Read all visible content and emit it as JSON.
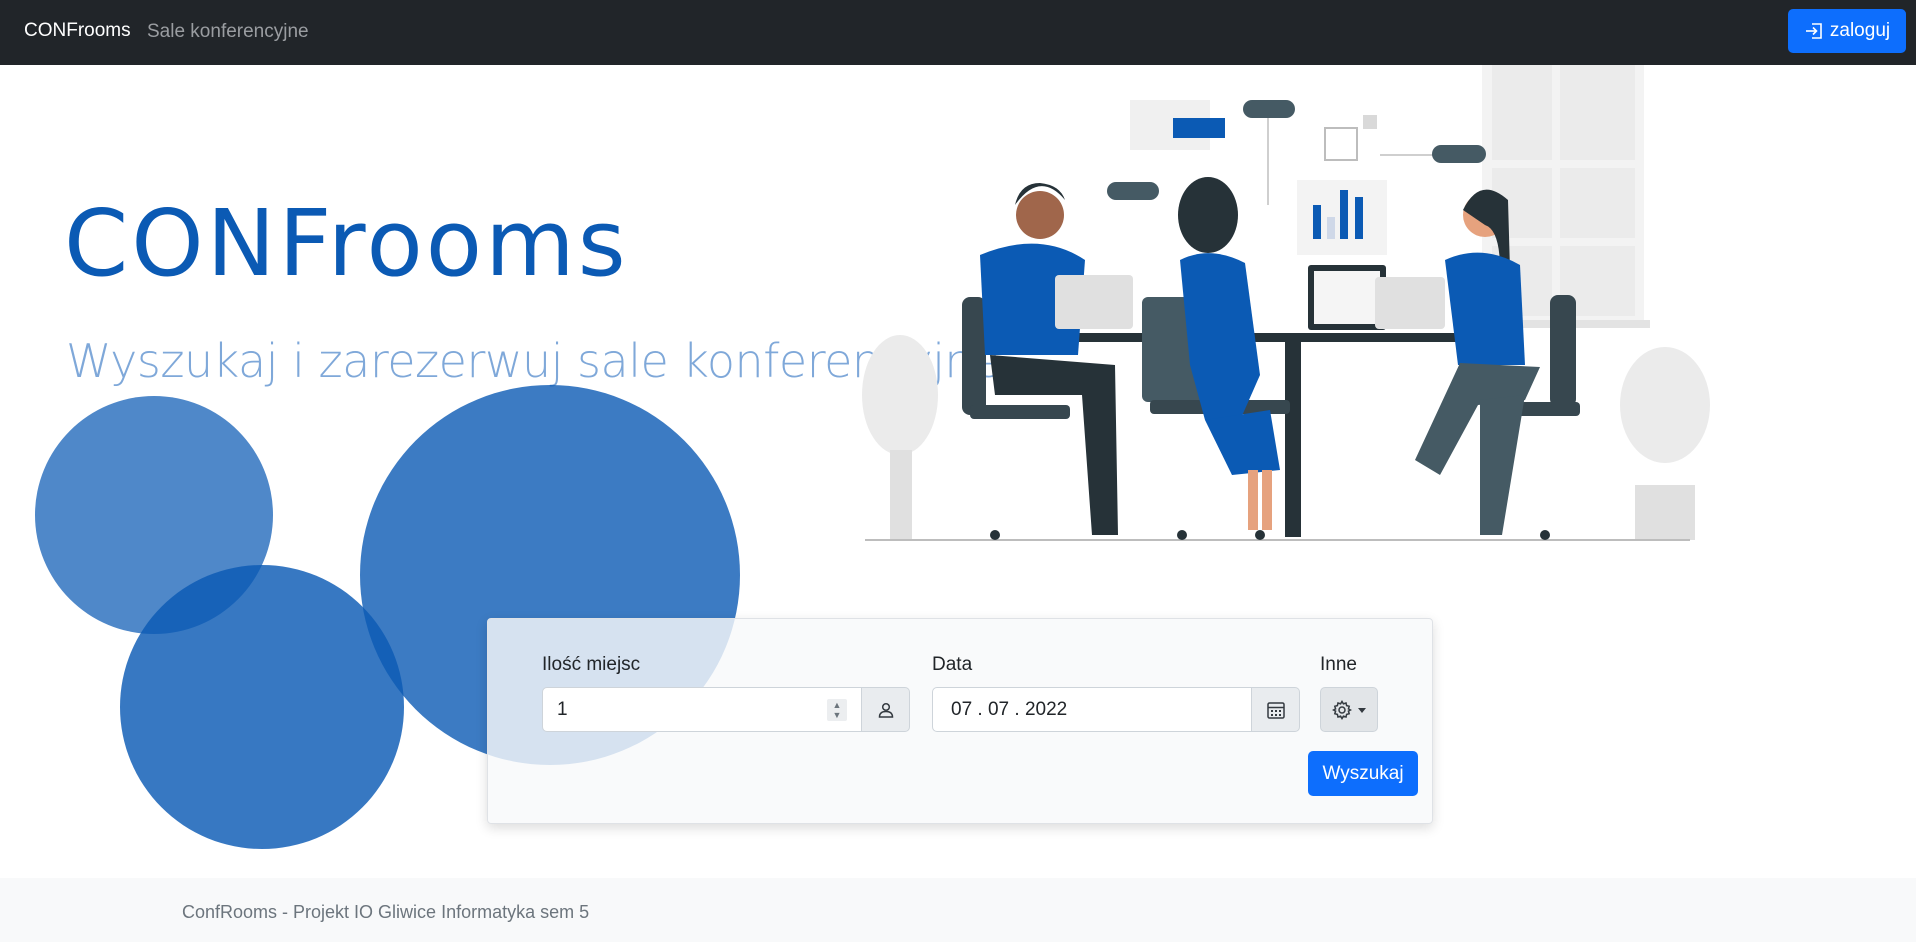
{
  "navbar": {
    "brand": "CONFrooms",
    "nav_link": "Sale konferencyjne",
    "login_label": "zaloguj",
    "login_icon": "login-icon"
  },
  "hero": {
    "title": "CONFrooms",
    "subtitle": "Wyszukaj i zarezerwuj sale konferencyjne"
  },
  "search": {
    "seats_label": "Ilość miejsc",
    "seats_value": "1",
    "seats_icon": "person-icon",
    "date_label": "Data",
    "date_value": "07 . 07 . 2022",
    "date_icon": "calendar-icon",
    "other_label": "Inne",
    "other_icon": "gear-icon",
    "search_button": "Wyszukaj"
  },
  "footer": {
    "text": "ConfRooms - Projekt IO Gliwice Informatyka sem 5"
  },
  "colors": {
    "navbar_bg": "#212529",
    "primary": "#0d6efd",
    "hero_title": "#0b5ab4",
    "hero_subtitle": "#7fa8d9",
    "circle_blue": "#0b5ab4"
  }
}
